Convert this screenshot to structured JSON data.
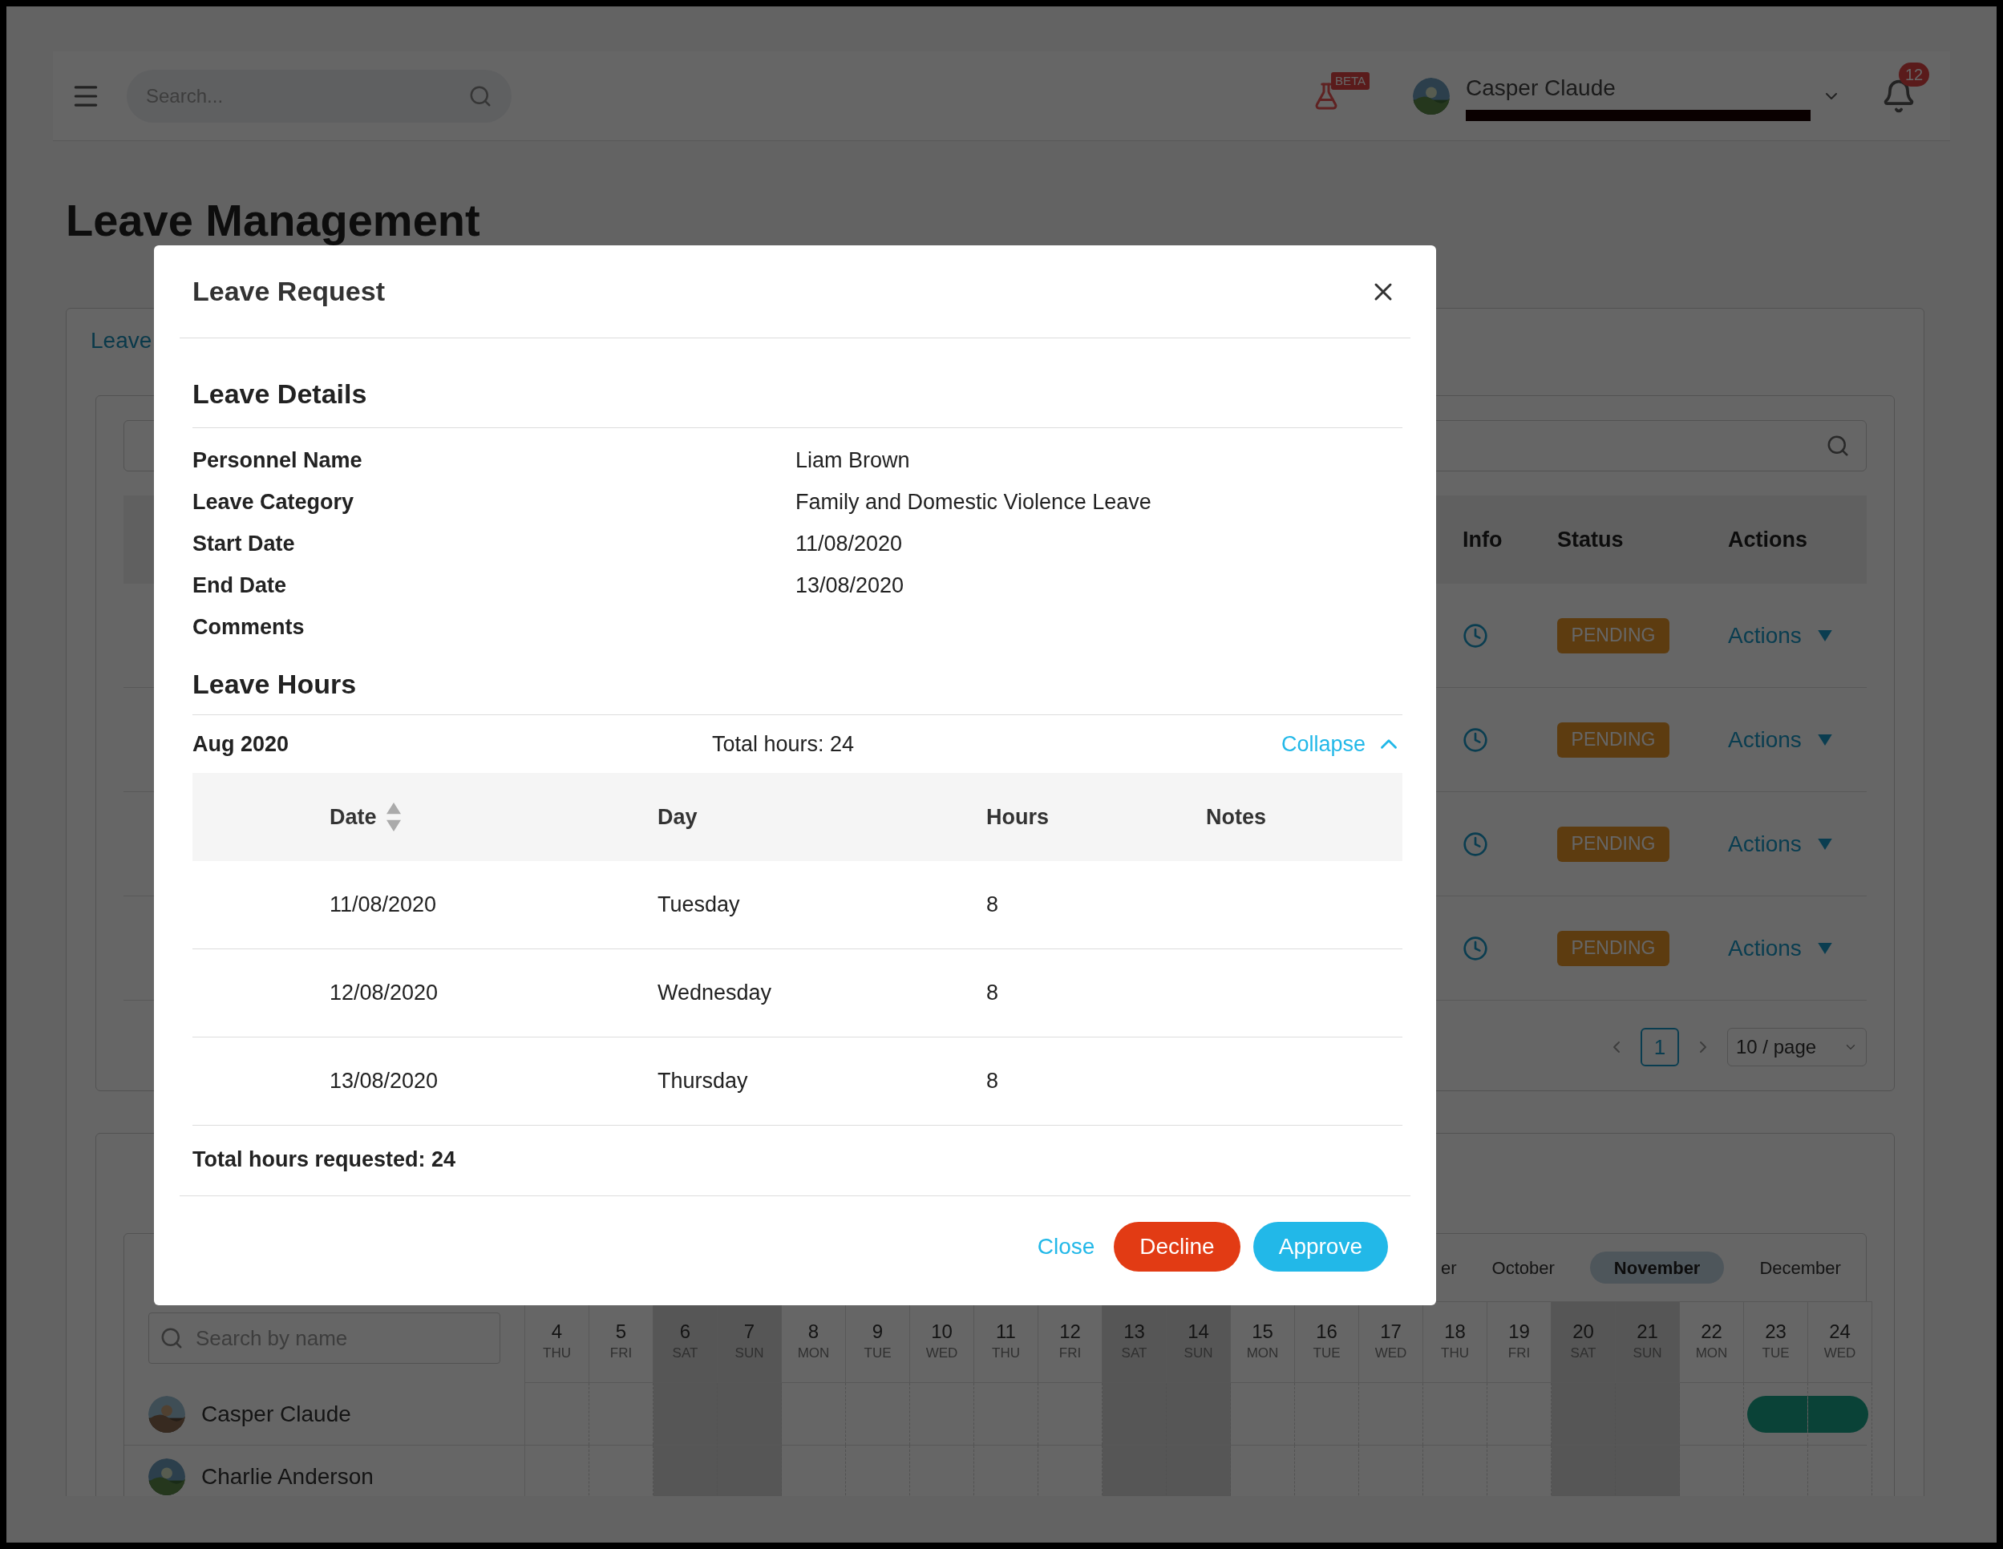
{
  "header": {
    "search_placeholder": "Search...",
    "beta_badge": "BETA",
    "user_name": "Casper Claude",
    "notification_count": "12"
  },
  "page_title": "Leave Management",
  "tabs": [
    {
      "label": "Leave",
      "selected": true
    }
  ],
  "requests_table": {
    "columns": [
      "Info",
      "Status",
      "Actions"
    ],
    "rows": [
      {
        "status": "PENDING",
        "action": "Actions"
      },
      {
        "status": "PENDING",
        "action": "Actions"
      },
      {
        "status": "PENDING",
        "action": "Actions"
      },
      {
        "status": "PENDING",
        "action": "Actions"
      }
    ]
  },
  "pagination": {
    "pages": [
      {
        "label": "1",
        "selected": true
      }
    ],
    "page_size": "10 / page"
  },
  "calendar": {
    "months": [
      {
        "label": "er",
        "selected": false
      },
      {
        "label": "October",
        "selected": false
      },
      {
        "label": "November",
        "selected": true
      },
      {
        "label": "December",
        "selected": false
      }
    ],
    "search_placeholder": "Search by name",
    "days": [
      {
        "date": "4",
        "weekday": "THU",
        "weekend": false
      },
      {
        "date": "5",
        "weekday": "FRI",
        "weekend": false
      },
      {
        "date": "6",
        "weekday": "SAT",
        "weekend": true
      },
      {
        "date": "7",
        "weekday": "SUN",
        "weekend": true
      },
      {
        "date": "8",
        "weekday": "MON",
        "weekend": false
      },
      {
        "date": "9",
        "weekday": "TUE",
        "weekend": false
      },
      {
        "date": "10",
        "weekday": "WED",
        "weekend": false
      },
      {
        "date": "11",
        "weekday": "THU",
        "weekend": false
      },
      {
        "date": "12",
        "weekday": "FRI",
        "weekend": false
      },
      {
        "date": "13",
        "weekday": "SAT",
        "weekend": true
      },
      {
        "date": "14",
        "weekday": "SUN",
        "weekend": true
      },
      {
        "date": "15",
        "weekday": "MON",
        "weekend": false
      },
      {
        "date": "16",
        "weekday": "TUE",
        "weekend": false
      },
      {
        "date": "17",
        "weekday": "WED",
        "weekend": false
      },
      {
        "date": "18",
        "weekday": "THU",
        "weekend": false
      },
      {
        "date": "19",
        "weekday": "FRI",
        "weekend": false
      },
      {
        "date": "20",
        "weekday": "SAT",
        "weekend": true
      },
      {
        "date": "21",
        "weekday": "SUN",
        "weekend": true
      },
      {
        "date": "22",
        "weekday": "MON",
        "weekend": false
      },
      {
        "date": "23",
        "weekday": "TUE",
        "weekend": false
      },
      {
        "date": "24",
        "weekday": "WED",
        "weekend": false
      }
    ],
    "people": [
      {
        "name": "Casper Claude",
        "on_leave": [
          false,
          false,
          false,
          false,
          false,
          false,
          false,
          false,
          false,
          false,
          false,
          false,
          false,
          false,
          false,
          false,
          false,
          false,
          false,
          true,
          true
        ]
      },
      {
        "name": "Charlie Anderson",
        "on_leave": [
          false,
          false,
          false,
          false,
          false,
          false,
          false,
          false,
          false,
          false,
          false,
          false,
          false,
          false,
          false,
          false,
          false,
          false,
          false,
          false,
          false
        ]
      }
    ]
  },
  "modal": {
    "title": "Leave Request",
    "details_heading": "Leave Details",
    "details": [
      {
        "label": "Personnel Name",
        "value": "Liam Brown"
      },
      {
        "label": "Leave Category",
        "value": "Family and Domestic Violence Leave"
      },
      {
        "label": "Start Date",
        "value": "11/08/2020"
      },
      {
        "label": "End Date",
        "value": "13/08/2020"
      },
      {
        "label": "Comments"
      }
    ],
    "hours_heading": "Leave Hours",
    "month": "Aug 2020",
    "total_hours": "Total hours: 24",
    "collapse": "Collapse",
    "expanded": true,
    "columns": [
      "Date",
      "Day",
      "Hours",
      "Notes"
    ],
    "rows": [
      {
        "date": "11/08/2020",
        "day": "Tuesday",
        "hours": "8"
      },
      {
        "date": "12/08/2020",
        "day": "Wednesday",
        "hours": "8"
      },
      {
        "date": "13/08/2020",
        "day": "Thursday",
        "hours": "8"
      }
    ],
    "total_requested": "Total hours requested: 24",
    "buttons": [
      {
        "kind": "link",
        "label": "Close"
      },
      {
        "kind": "danger",
        "label": "Decline"
      },
      {
        "kind": "primary",
        "label": "Approve"
      }
    ]
  }
}
